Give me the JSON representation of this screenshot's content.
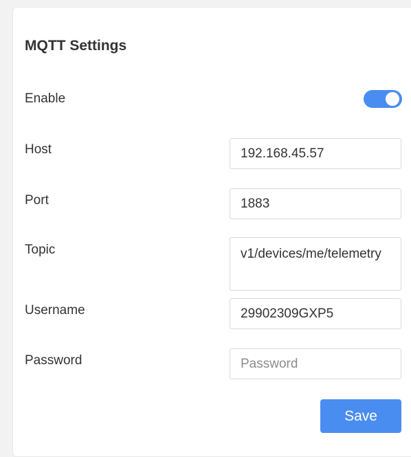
{
  "panel": {
    "title": "MQTT Settings"
  },
  "enable": {
    "label": "Enable",
    "value": true,
    "accent_color": "#4a8df0"
  },
  "host": {
    "label": "Host",
    "value": "192.168.45.57"
  },
  "port": {
    "label": "Port",
    "value": "1883"
  },
  "topic": {
    "label": "Topic",
    "value": "v1/devices/me/telemetry"
  },
  "username": {
    "label": "Username",
    "value": "29902309GXP5"
  },
  "password": {
    "label": "Password",
    "value": "",
    "placeholder": "Password"
  },
  "actions": {
    "save_label": "Save"
  }
}
